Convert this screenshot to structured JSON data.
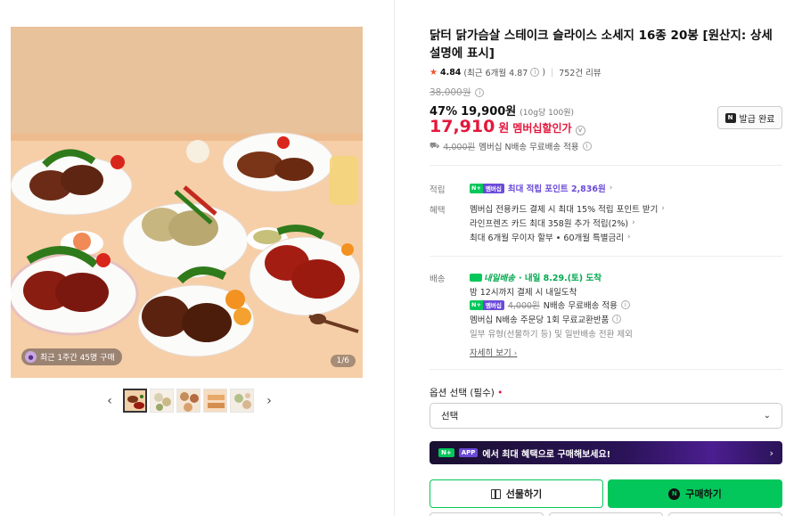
{
  "gallery": {
    "badge_text": "최근 1주간 45명 구매",
    "counter": "1/6",
    "thumbnail_count": 5,
    "selected_index": 0
  },
  "product": {
    "title": "닭터 닭가슴살 스테이크 슬라이스 소세지 16종 20봉 [원산지: 상세설명에 표시]",
    "rating": {
      "score": "4.84",
      "recent": "(최근 6개월 4.87",
      "recent_close": ")",
      "review_count": "752건 리뷰"
    },
    "price": {
      "original": "38,000원",
      "discount_pct": "47%",
      "discount_price": "19,900원",
      "unit_price": "(10g당 100원)",
      "member_price": "17,910",
      "member_unit": "원",
      "member_label": "멤버십할인가"
    },
    "coupon_button": "발급 완료",
    "shipping_line": {
      "strike": "4,000원",
      "text": "멤버십 N배송 무료배송 적용"
    }
  },
  "benefits": {
    "points_label": "적립",
    "points_badge_n": "N+",
    "points_badge_m": "멤버십",
    "points_text": "최대 적립 포인트 2,836원",
    "perks_label": "혜택",
    "perks": [
      "멤버십 전용카드 결제 시 최대 15% 적립 포인트 받기",
      "라인프렌즈 카드 최대 358원 추가 적립(2%)",
      "최대 6개월 무이자 할부 • 60개월 특별금리"
    ]
  },
  "delivery": {
    "label": "배송",
    "today_badge": "내일배송",
    "arrival": "· 내일 8.29.(토) 도착",
    "cutoff": "밤 12시까지 결제 시 내일도착",
    "free_badge_n": "N+",
    "free_badge_m": "멤버십",
    "free_strike": "4,000원",
    "free_text": "N배송 무료배송 적용",
    "exchange": "멤버십 N배송 주문당 1회 무료교환반품",
    "note": "일부 유형(선물하기 등) 및 일반배송 전환 제외",
    "detail_link": "자세히 보기"
  },
  "option": {
    "title": "옵션 선택 (필수)",
    "required_mark": "•",
    "select_value": "선택"
  },
  "app_banner": {
    "n_badge": "N+",
    "app_badge": "APP",
    "text": "에서 최대 혜택으로 구매해보세요!"
  },
  "actions": {
    "gift": "선물하기",
    "buy": "구매하기"
  },
  "colors": {
    "accent_green": "#03c75a",
    "price_red": "#e4173c",
    "membership_purple": "#6b4bd8"
  }
}
